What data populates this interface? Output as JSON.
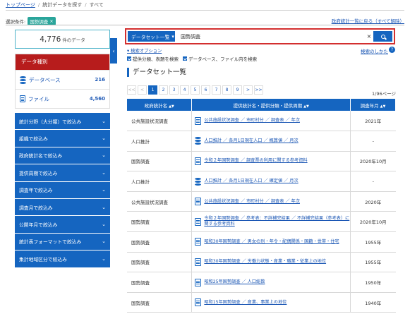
{
  "breadcrumb": {
    "home": "トップページ",
    "sep": "/",
    "find": "統計データを探す",
    "current": "すべて"
  },
  "condition": {
    "label": "選択条件:",
    "chip": "国勢調査",
    "chip_close": "×",
    "back_link": "政府統計一覧に戻る（すべて解除）"
  },
  "sidebar": {
    "count": "4,776",
    "count_unit": "件のデータ",
    "collapse": "‹",
    "data_type_title": "データ種別",
    "types": [
      {
        "label": "データベース",
        "count": "216"
      },
      {
        "label": "ファイル",
        "count": "4,560"
      }
    ],
    "filters": [
      "統計分野（大分類）で絞込み",
      "組織で絞込み",
      "政府統計名で絞込み",
      "提供周期で絞込み",
      "調査年で絞込み",
      "調査月で絞込み",
      "公開年月で絞込み",
      "統計表フォーマットで絞込み",
      "集計地域区分で絞込み"
    ],
    "chevron": "⌄"
  },
  "search": {
    "select_label": "データセット一覧",
    "select_arrow": "▾",
    "value": "国勢調査",
    "clear": "×",
    "options_link": "▾ 検索オプション",
    "howto": "検索のしかた",
    "help": "?",
    "check1": "提供分類、表題を検索",
    "check2": "データベース、ファイル内を検索"
  },
  "section_title": "データセット一覧",
  "pager": {
    "items": [
      "<<",
      "<",
      "1",
      "2",
      "3",
      "4",
      "5",
      "6",
      "7",
      "8",
      "9",
      ">",
      ">>"
    ],
    "info": "1/96ページ"
  },
  "table": {
    "headers": [
      "政府統計名",
      "提供統計名・提供分類・提供周期",
      "調査年月"
    ],
    "sort_icon": "▲▼",
    "rows": [
      {
        "stat": "公共施設状況調査",
        "title": "公共施設状況調査 ／ 市町村分 ／ 調査表 ／ 年次",
        "date": "2021年",
        "icon": "doc"
      },
      {
        "stat": "人口推計",
        "title": "人口推計 ／ 各月1日現在人口 ／ 概算値 ／ 月次",
        "date": "-",
        "icon": "db"
      },
      {
        "stat": "国勢調査",
        "title": "令和２年国勢調査 ／ 調査票の利用に関する参考資料",
        "date": "2020年10月",
        "icon": "doc"
      },
      {
        "stat": "人口推計",
        "title": "人口推計 ／ 各月1日現在人口 ／ 確定値 ／ 月次",
        "date": "-",
        "icon": "db"
      },
      {
        "stat": "公共施設状況調査",
        "title": "公共施設状況調査 ／ 市町村分 ／ 調査表 ／ 年次",
        "date": "2020年",
        "icon": "doc"
      },
      {
        "stat": "国勢調査",
        "title": "令和２年国勢調査 ／ 参考表：不詳補完結果 ／ 不詳補完結果（参考表）に関する参考資料",
        "date": "2020年10月",
        "icon": "doc"
      },
      {
        "stat": "国勢調査",
        "title": "昭和30年国勢調査 ／ 男女の別・年令・配偶関係・国籍・世帯・住宅",
        "date": "1955年",
        "icon": "doc"
      },
      {
        "stat": "国勢調査",
        "title": "昭和30年国勢調査 ／ 労働力状態・産業・職業・従業上の地位",
        "date": "1955年",
        "icon": "doc"
      },
      {
        "stat": "国勢調査",
        "title": "昭和25年国勢調査 ／ 人口総数",
        "date": "1950年",
        "icon": "doc"
      },
      {
        "stat": "国勢調査",
        "title": "昭和15年国勢調査 ／ 産業、事業上の地位",
        "date": "1940年",
        "icon": "doc"
      }
    ]
  }
}
